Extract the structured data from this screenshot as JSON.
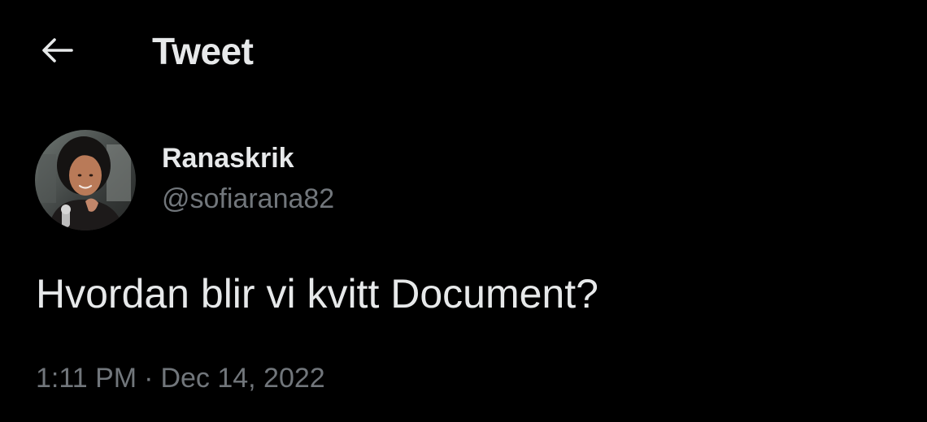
{
  "header": {
    "back_icon": "arrow-left-icon",
    "title": "Tweet"
  },
  "tweet": {
    "author": {
      "display_name": "Ranaskrik",
      "handle": "@sofiarana82",
      "avatar": "profile-photo"
    },
    "text": "Hvordan blir vi kvitt Document?",
    "time": "1:11 PM",
    "separator": "·",
    "date": "Dec 14, 2022"
  },
  "colors": {
    "background": "#000000",
    "primary_text": "#e7e9ea",
    "secondary_text": "#71767b"
  }
}
